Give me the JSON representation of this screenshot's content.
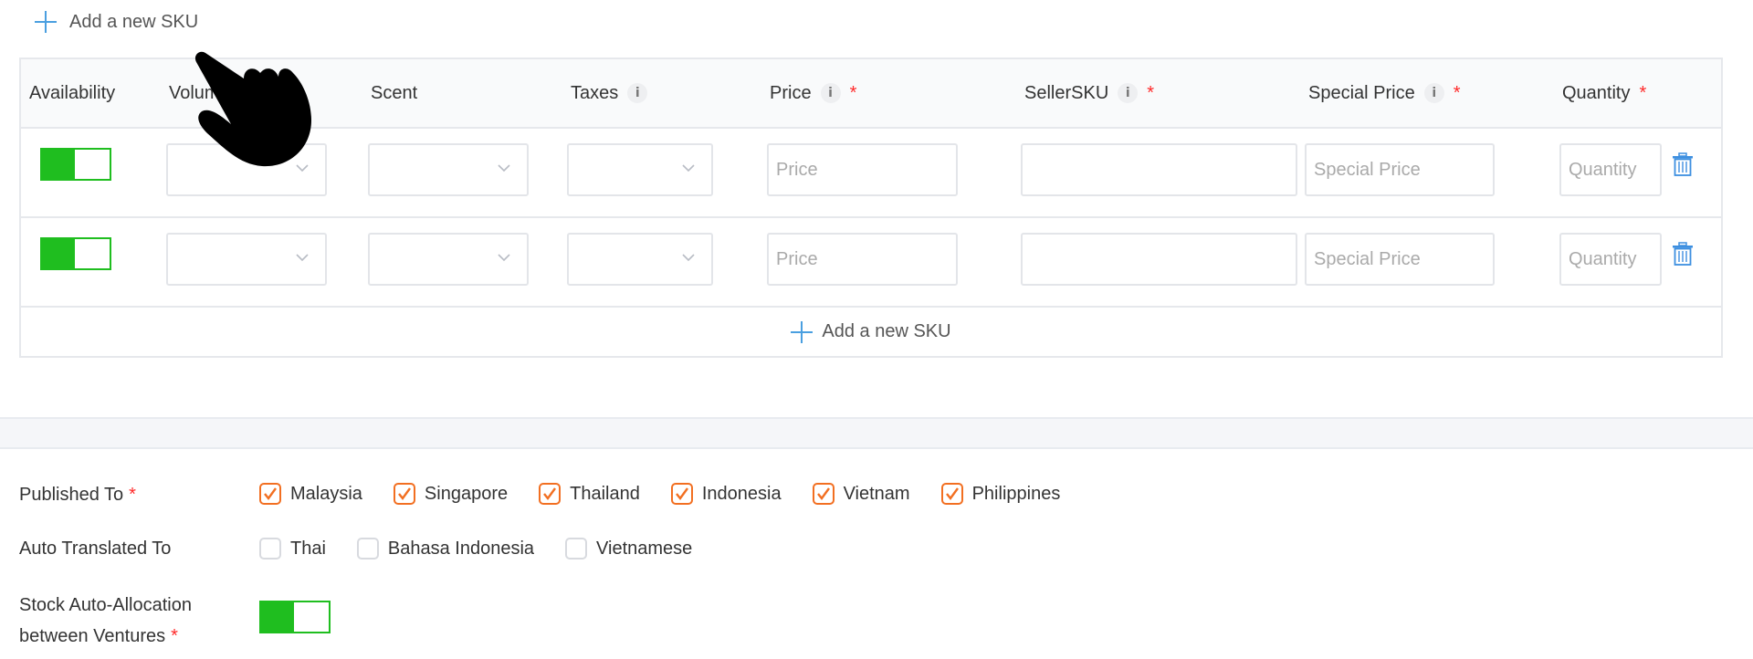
{
  "top_action": {
    "icon": "plus-icon",
    "label": "Add a new SKU"
  },
  "sku_table": {
    "columns": [
      {
        "label": "Availability",
        "info": false,
        "required": false
      },
      {
        "label": "Volume",
        "info": false,
        "required": false
      },
      {
        "label": "Scent",
        "info": false,
        "required": false
      },
      {
        "label": "Taxes",
        "info": true,
        "required": false
      },
      {
        "label": "Price",
        "info": true,
        "required": true
      },
      {
        "label": "SellerSKU",
        "info": true,
        "required": true
      },
      {
        "label": "Special Price",
        "info": true,
        "required": true
      },
      {
        "label": "Quantity",
        "info": false,
        "required": true
      }
    ],
    "info_glyph": "i",
    "required_mark": "*",
    "rows": [
      {
        "availability": true,
        "volume": "",
        "scent": "",
        "taxes": "",
        "price": "",
        "seller_sku": "",
        "special_price": "",
        "quantity": ""
      },
      {
        "availability": true,
        "volume": "",
        "scent": "",
        "taxes": "",
        "price": "",
        "seller_sku": "",
        "special_price": "",
        "quantity": ""
      }
    ],
    "placeholders": {
      "price": "Price",
      "special_price": "Special Price",
      "quantity": "Quantity"
    },
    "footer_action": {
      "icon": "plus-icon",
      "label": "Add a new SKU"
    }
  },
  "publish": {
    "published_to": {
      "label": "Published To",
      "required_mark": "*",
      "options": [
        {
          "label": "Malaysia",
          "checked": true
        },
        {
          "label": "Singapore",
          "checked": true
        },
        {
          "label": "Thailand",
          "checked": true
        },
        {
          "label": "Indonesia",
          "checked": true
        },
        {
          "label": "Vietnam",
          "checked": true
        },
        {
          "label": "Philippines",
          "checked": true
        }
      ]
    },
    "auto_translated_to": {
      "label": "Auto Translated To",
      "options": [
        {
          "label": "Thai",
          "checked": false
        },
        {
          "label": "Bahasa Indonesia",
          "checked": false
        },
        {
          "label": "Vietnamese",
          "checked": false
        }
      ]
    },
    "stock_allocation": {
      "label_line1": "Stock Auto-Allocation",
      "label_line2": "between Ventures",
      "required_mark": "*",
      "enabled": true
    }
  },
  "colors": {
    "accent": "#4a9fe0",
    "toggle_on": "#1fbe1f",
    "checkbox_checked": "#f26f21",
    "required": "#ff2a2a"
  }
}
